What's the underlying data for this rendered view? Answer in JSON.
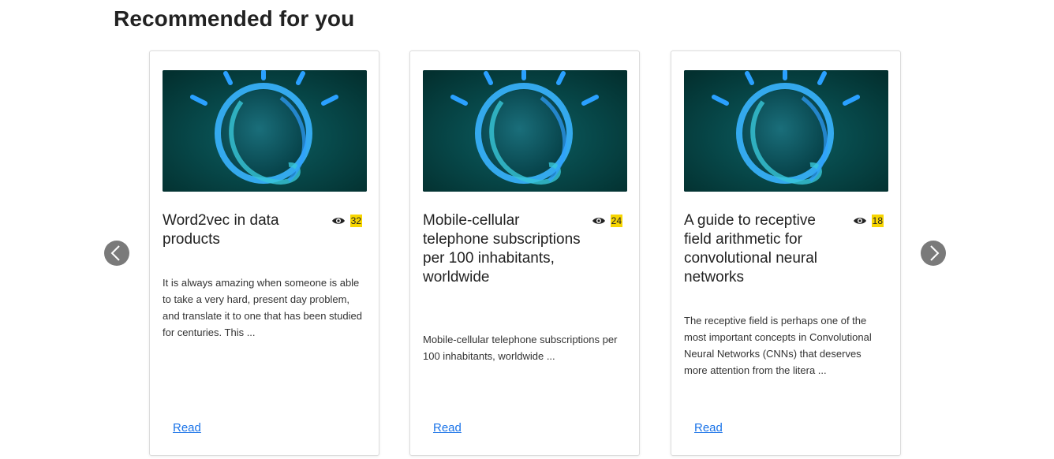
{
  "section": {
    "title": "Recommended for you"
  },
  "cards": [
    {
      "title": "Word2vec in data products",
      "views": "32",
      "description": "It is always amazing when someone is able to take a very hard, present day problem, and translate it to one that has been studied for centuries. This ...",
      "read_label": "Read"
    },
    {
      "title": "Mobile-cellular telephone subscriptions per 100 inhabitants, worldwide",
      "views": "24",
      "description": "Mobile-cellular telephone subscriptions per 100 inhabitants, worldwide ...",
      "read_label": "Read"
    },
    {
      "title": "A guide to receptive field arithmetic for convolutional neural networks",
      "views": "18",
      "description": "The receptive field is perhaps one of the most important concepts in Convolutional Neural Networks (CNNs) that deserves more attention from the litera ...",
      "read_label": "Read"
    }
  ],
  "icons": {
    "prev": "chevron-left-icon",
    "next": "chevron-right-icon",
    "views": "eye-icon"
  },
  "colors": {
    "link": "#1a73e8",
    "badge_highlight": "#f7d500",
    "image_background": "#04393c",
    "arrow_background": "#7a7a7a"
  }
}
